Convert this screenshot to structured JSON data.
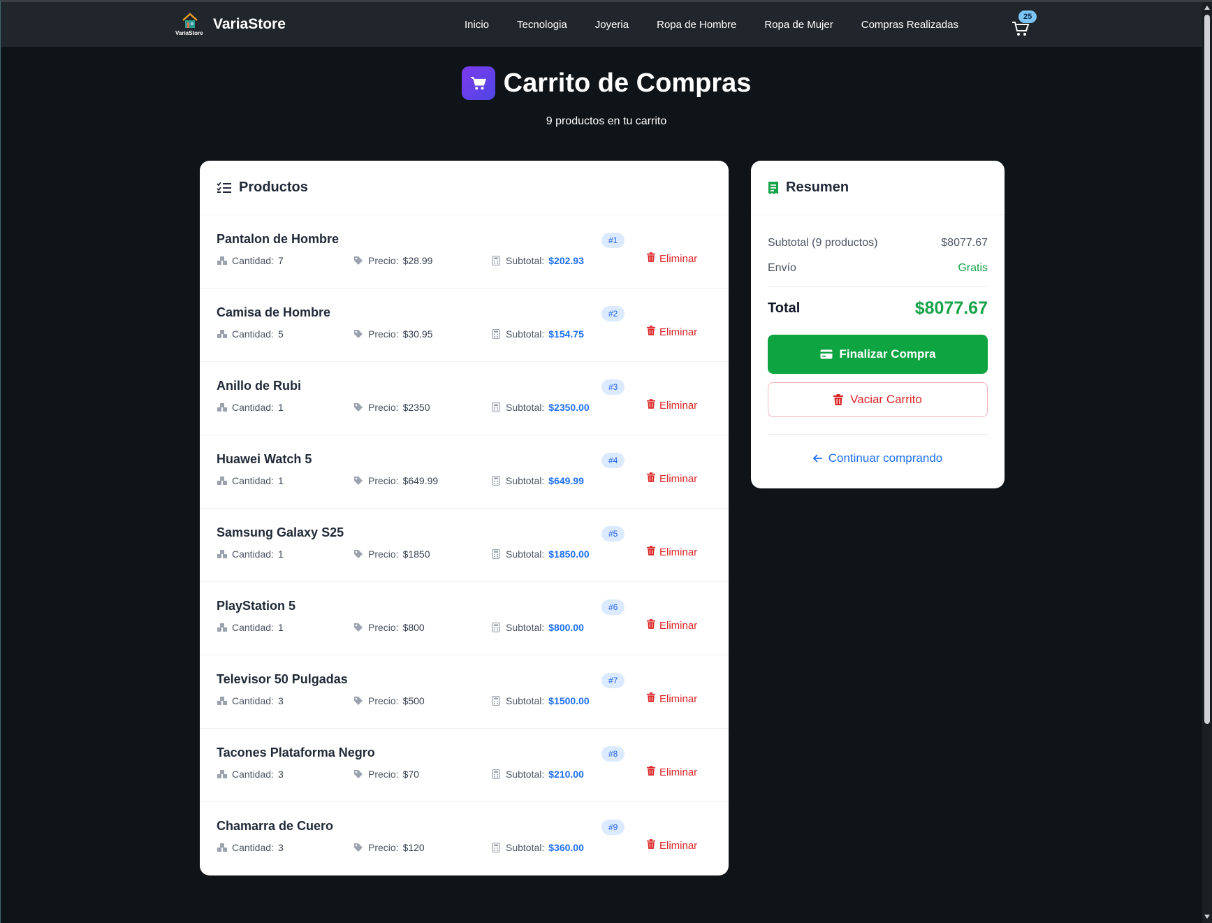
{
  "brand": {
    "name": "VariaStore",
    "logo_text": "VariaStore"
  },
  "nav": {
    "links": [
      "Inicio",
      "Tecnologia",
      "Joyeria",
      "Ropa de Hombre",
      "Ropa de Mujer",
      "Compras Realizadas"
    ],
    "cart_count": "25"
  },
  "header": {
    "title": "Carrito de Compras",
    "subtitle": "9 productos en tu carrito"
  },
  "products_card": {
    "title": "Productos",
    "qty_label": "Cantidad:",
    "price_label": "Precio:",
    "subtotal_label": "Subtotal:",
    "remove_label": "Eliminar",
    "items": [
      {
        "name": "Pantalon de Hombre",
        "num": "#1",
        "qty": "7",
        "price": "$28.99",
        "subtotal": "$202.93"
      },
      {
        "name": "Camisa de Hombre",
        "num": "#2",
        "qty": "5",
        "price": "$30.95",
        "subtotal": "$154.75"
      },
      {
        "name": "Anillo de Rubi",
        "num": "#3",
        "qty": "1",
        "price": "$2350",
        "subtotal": "$2350.00"
      },
      {
        "name": "Huawei Watch 5",
        "num": "#4",
        "qty": "1",
        "price": "$649.99",
        "subtotal": "$649.99"
      },
      {
        "name": "Samsung Galaxy S25",
        "num": "#5",
        "qty": "1",
        "price": "$1850",
        "subtotal": "$1850.00"
      },
      {
        "name": "PlayStation 5",
        "num": "#6",
        "qty": "1",
        "price": "$800",
        "subtotal": "$800.00"
      },
      {
        "name": "Televisor 50 Pulgadas",
        "num": "#7",
        "qty": "3",
        "price": "$500",
        "subtotal": "$1500.00"
      },
      {
        "name": "Tacones Plataforma Negro",
        "num": "#8",
        "qty": "3",
        "price": "$70",
        "subtotal": "$210.00"
      },
      {
        "name": "Chamarra de Cuero",
        "num": "#9",
        "qty": "3",
        "price": "$120",
        "subtotal": "$360.00"
      }
    ]
  },
  "summary": {
    "title": "Resumen",
    "subtotal_label": "Subtotal (9 productos)",
    "subtotal_value": "$8077.67",
    "shipping_label": "Envío",
    "shipping_value": "Gratis",
    "total_label": "Total",
    "total_value": "$8077.67",
    "checkout_label": "Finalizar Compra",
    "empty_label": "Vaciar Carrito",
    "continue_label": "Continuar comprando"
  },
  "colors": {
    "accent_blue": "#1d6ff2",
    "success_green": "#16a34a",
    "danger_red": "#dc2626",
    "navbar_bg": "#21262c",
    "page_bg": "#0f1418"
  }
}
